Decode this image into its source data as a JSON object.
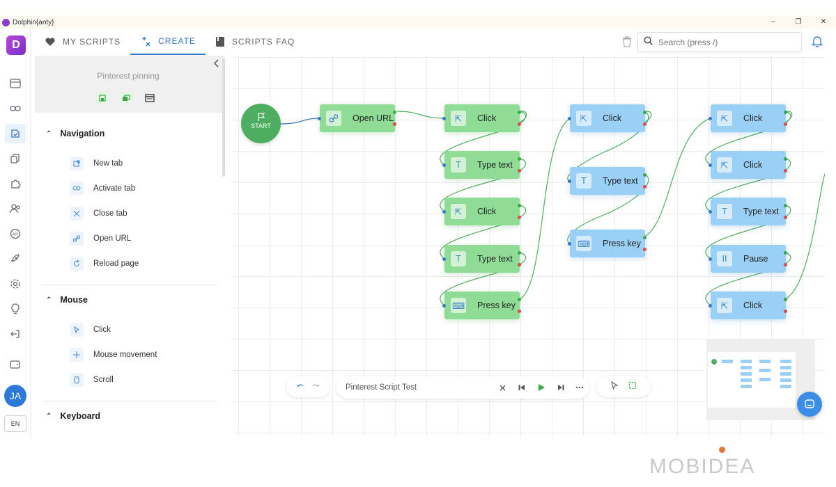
{
  "app": {
    "title": "Dolphin{anty}",
    "win_controls": [
      "–",
      "❐",
      "✕"
    ]
  },
  "rail": {
    "logo": "D",
    "avatar": "JA",
    "lang": "EN",
    "icons": [
      "browser-icon",
      "link-icon",
      "scripts-icon",
      "copy-icon",
      "puzzle-icon",
      "users-icon",
      "api-icon",
      "rocket-icon",
      "settings-icon",
      "bulb-icon",
      "logout-icon",
      "wallet-icon"
    ]
  },
  "tabs": [
    {
      "label": "MY SCRIPTS",
      "icon": "heart-icon"
    },
    {
      "label": "CREATE",
      "icon": "magic-icon"
    },
    {
      "label": "SCRIPTS FAQ",
      "icon": "book-icon"
    }
  ],
  "search": {
    "placeholder": "Search (press /)"
  },
  "panel": {
    "script_name": "Pinterest pinning",
    "sections": [
      {
        "title": "Navigation",
        "items": [
          "New tab",
          "Activate tab",
          "Close tab",
          "Open URL",
          "Reload page"
        ]
      },
      {
        "title": "Mouse",
        "items": [
          "Click",
          "Mouse movement",
          "Scroll"
        ]
      },
      {
        "title": "Keyboard",
        "items": []
      }
    ]
  },
  "canvas": {
    "start_label": "START",
    "nodes": [
      {
        "label": "Open URL",
        "color": "green"
      },
      {
        "label": "Click",
        "color": "green"
      },
      {
        "label": "Type text",
        "color": "green"
      },
      {
        "label": "Click",
        "color": "green"
      },
      {
        "label": "Type text",
        "color": "green"
      },
      {
        "label": "Press key",
        "color": "green"
      },
      {
        "label": "Click",
        "color": "blue"
      },
      {
        "label": "Type text",
        "color": "blue"
      },
      {
        "label": "Press key",
        "color": "blue"
      },
      {
        "label": "Click",
        "color": "blue"
      },
      {
        "label": "Click",
        "color": "blue"
      },
      {
        "label": "Type text",
        "color": "blue"
      },
      {
        "label": "Pause",
        "color": "blue"
      },
      {
        "label": "Click",
        "color": "blue"
      }
    ]
  },
  "toolbar": {
    "script_name": "Pinterest Script Test"
  },
  "watermark": "MOBIDEA",
  "colors": {
    "accent": "#3a78c8",
    "green_node": "#8fdc97",
    "blue_node": "#9ad0f5",
    "start": "#4cae5e"
  }
}
